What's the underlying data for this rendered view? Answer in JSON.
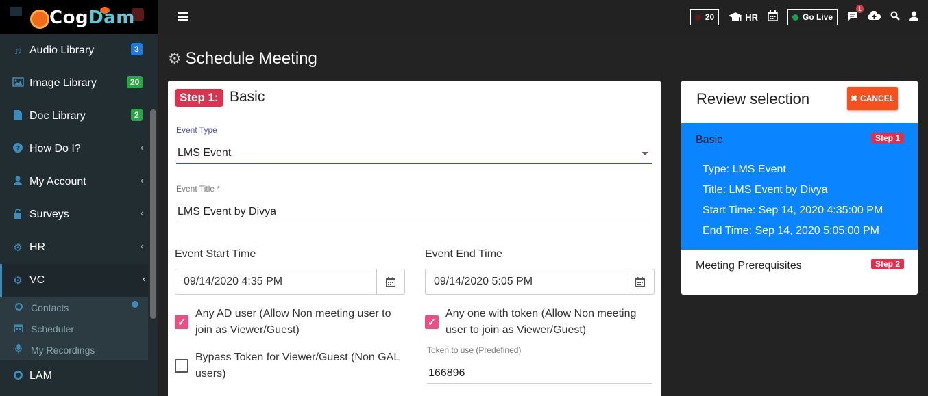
{
  "app": {
    "logo_text_a": "Cog",
    "logo_text_b": "Dam"
  },
  "topbar": {
    "counter_value": "20",
    "counter_dot_color": "#5a1a1a",
    "hr_label": "HR",
    "golive_label": "Go Live",
    "golive_dot_color": "#1aa053",
    "notification_count": "1",
    "icons": [
      "menu-icon",
      "graduation-cap-icon",
      "calendar-icon",
      "comment-icon",
      "cloud-upload-icon",
      "search-icon",
      "user-icon"
    ]
  },
  "sidebar": {
    "items": [
      {
        "label": "Audio Library",
        "badge": "3",
        "badge_color": "#1f7ae0",
        "icon": "music-icon"
      },
      {
        "label": "Image Library",
        "badge": "20",
        "badge_color": "#28a745",
        "icon": "image-icon"
      },
      {
        "label": "Doc Library",
        "badge": "2",
        "badge_color": "#28a745",
        "icon": "file-icon"
      },
      {
        "label": "How Do I?",
        "icon": "question-circle-icon"
      },
      {
        "label": "My Account",
        "icon": "user-icon"
      },
      {
        "label": "Surveys",
        "icon": "unlock-icon"
      },
      {
        "label": "HR",
        "icon": "cogs-icon"
      },
      {
        "label": "VC",
        "icon": "cogs-icon"
      }
    ],
    "submenu": [
      {
        "label": "Contacts",
        "icon": "circle-icon"
      },
      {
        "label": "Scheduler",
        "icon": "calendar-icon"
      },
      {
        "label": "My Recordings",
        "icon": "microphone-icon"
      }
    ],
    "lam_label": "LAM"
  },
  "page": {
    "title": "Schedule Meeting"
  },
  "form": {
    "step_badge": "Step 1:",
    "step_title": "Basic",
    "event_type_label": "Event Type",
    "event_type_value": "LMS Event",
    "event_title_label": "Event Title *",
    "event_title_value": "LMS Event by Divya",
    "start_label": "Event Start Time",
    "start_value": "09/14/2020 4:35 PM",
    "end_label": "Event End Time",
    "end_value": "09/14/2020 5:05 PM",
    "any_ad_user_line1": "Any AD user (Allow Non meeting user to",
    "any_ad_user_line2": "join as Viewer/Guest)",
    "any_token_line1": "Any one with token (Allow Non meeting",
    "any_token_line2": "user to join as Viewer/Guest)",
    "bypass_line1": "Bypass Token for Viewer/Guest (Non GAL",
    "bypass_line2": "users)",
    "token_label": "Token to use (Predefined)",
    "token_value": "166896",
    "any_ad_user_checked": true,
    "any_token_checked": true,
    "bypass_checked": false
  },
  "review": {
    "title": "Review selection",
    "cancel_label": "CANCEL",
    "section1_title": "Basic",
    "section1_step": "Step 1",
    "type_line": "Type: LMS Event",
    "title_line": "Title: LMS Event by Divya",
    "start_line": "Start Time: Sep 14, 2020 4:35:00 PM",
    "end_line": "End Time: Sep 14, 2020 5:05:00 PM",
    "section2_title": "Meeting Prerequisites",
    "section2_step": "Step 2",
    "highlight_color": "#0a84ff"
  }
}
